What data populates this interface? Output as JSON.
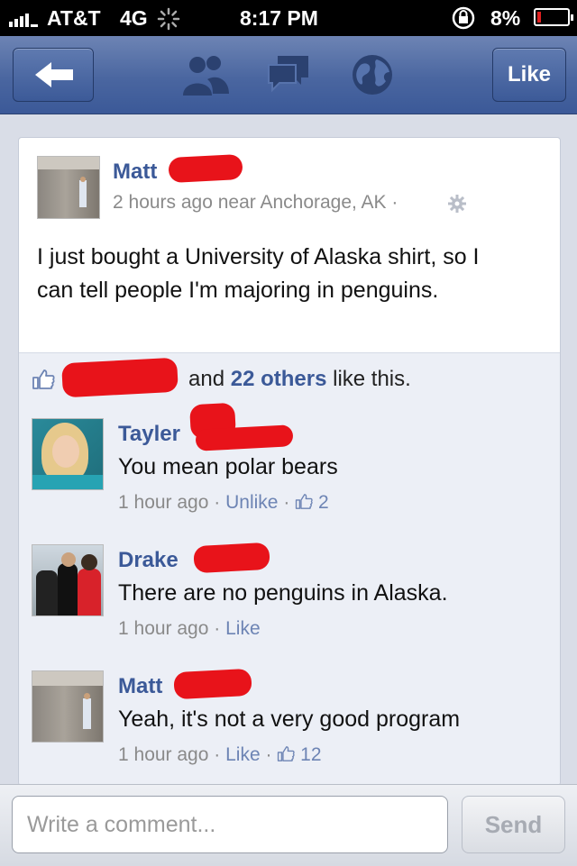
{
  "status_bar": {
    "carrier": "AT&T",
    "network": "4G",
    "time": "8:17 PM",
    "battery": "8%"
  },
  "nav": {
    "like_button": "Like",
    "icons": [
      "back-arrow-icon",
      "friends-icon",
      "messages-icon",
      "globe-icon"
    ]
  },
  "post": {
    "author": "Matt",
    "meta_time": "2 hours ago near Anchorage, AK",
    "meta_sep": "·",
    "text_line1": "I just bought a University of Alaska shirt, so I",
    "text_line2": "can tell people I'm majoring in penguins."
  },
  "likes": {
    "mid": "and",
    "others": "22 others",
    "suffix": "like this."
  },
  "comments": [
    {
      "name": "Tayler",
      "text": "You mean polar bears",
      "time": "1 hour ago",
      "sep": "·",
      "action": "Unlike",
      "like_count": "2"
    },
    {
      "name": "Drake",
      "text": "There are no penguins in Alaska.",
      "time": "1 hour ago",
      "sep": "·",
      "action": "Like",
      "like_count": ""
    },
    {
      "name": "Matt",
      "text": "Yeah, it's not a very good program",
      "time": "1 hour ago",
      "sep": "·",
      "action": "Like",
      "like_count": "12"
    }
  ],
  "composer": {
    "placeholder": "Write a comment...",
    "send_label": "Send"
  },
  "colors": {
    "brand": "#3b5998",
    "redaction": "#e8131a",
    "battery_low": "#e02020"
  }
}
